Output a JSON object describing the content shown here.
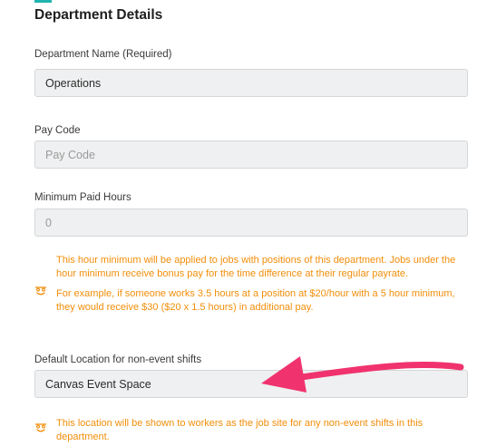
{
  "section": {
    "title": "Department Details"
  },
  "department_name": {
    "label": "Department Name (Required)",
    "value": "Operations"
  },
  "pay_code": {
    "label": "Pay Code",
    "placeholder": "Pay Code",
    "value": ""
  },
  "minimum_paid_hours": {
    "label": "Minimum Paid Hours",
    "value": "0",
    "note_paragraph_1": "This hour minimum will be applied to jobs with positions of this department. Jobs under the hour minimum receive bonus pay for the time difference at their regular payrate.",
    "note_paragraph_2": "For example, if someone works 3.5 hours at a position at $20/hour with a 5 hour minimum, they would receive $30 ($20 x 1.5 hours) in additional pay."
  },
  "default_location": {
    "label": "Default Location for non-event shifts",
    "value": "Canvas Event Space",
    "note": "This location will be shown to workers as the job site for any non-event shifts in this department."
  },
  "icons": {
    "note_icon": "info-face-icon",
    "annotation": "arrow-icon"
  },
  "colors": {
    "accent": "#1fb3b0",
    "note_text": "#f18e0a",
    "annotation_arrow": "#f0336e",
    "field_background": "#eff0f1"
  }
}
